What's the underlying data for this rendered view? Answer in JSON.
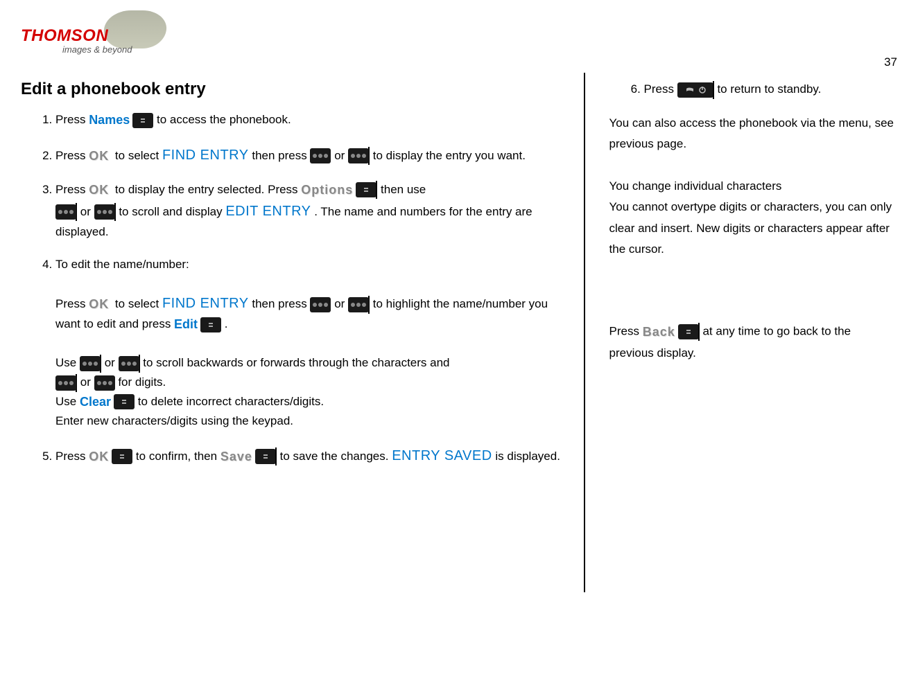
{
  "brand": {
    "name": "THOMSON",
    "tagline": "images & beyond"
  },
  "page_number": "37",
  "heading": "Edit a phonebook entry",
  "steps": {
    "1": {
      "t1": "Press ",
      "btn_names": "Names",
      "t2": "to access the phonebook."
    },
    "2": {
      "t1": "Press ",
      "ok": "OK",
      "t2": "to select ",
      "findentry": "FIND ENTRY",
      "t3": " then press ",
      "t4": "or ",
      "t5": "to display the entry you want."
    },
    "3": {
      "t1": "Press ",
      "ok": "OK",
      "t2": "to display the entry selected. Press ",
      "options": "Options",
      "t3": "then use ",
      "t4": "or ",
      "t5": "to scroll and display ",
      "editentry": "EDIT ENTRY",
      "t6": ". The name and numbers for the entry are displayed."
    },
    "4": {
      "intro": "To edit the name/number:",
      "p1_a": "Press ",
      "ok": "OK",
      "p1_b": "to select ",
      "findentry": "FIND ENTRY",
      "p1_c": " then press ",
      "p1_d": "or ",
      "p1_e": "to highlight the name/number you want to edit and press ",
      "edit": "Edit",
      "p1_f": ".",
      "p2_a": "Use ",
      "p2_b": "or ",
      "p2_c": "to scroll backwards or forwards through the characters and ",
      "p2_d": "or ",
      "p2_e": "for digits.",
      "p3_a": "Use ",
      "clear": "Clear",
      "p3_b": " to delete incorrect characters/digits.",
      "p4": "Enter new characters/digits using the keypad."
    },
    "5": {
      "t1": "Press ",
      "ok": "OK",
      "t2": " to confirm, then ",
      "save": "Save",
      "t3": "to save the changes.  ",
      "entrysaved": "ENTRY SAVED",
      "t4": " is displayed."
    },
    "6": {
      "t1": "Press ",
      "t2": "to return to standby."
    }
  },
  "side": {
    "p1": "You can also access the phonebook via the menu, see previous page.",
    "p2a": "You change individual characters",
    "p2b": "You cannot overtype digits or characters, you can only clear and insert.  New digits or characters appear after the cursor.",
    "p3_a": "Press ",
    "back": "Back",
    "p3_b": "at any time to go back to the previous display."
  }
}
